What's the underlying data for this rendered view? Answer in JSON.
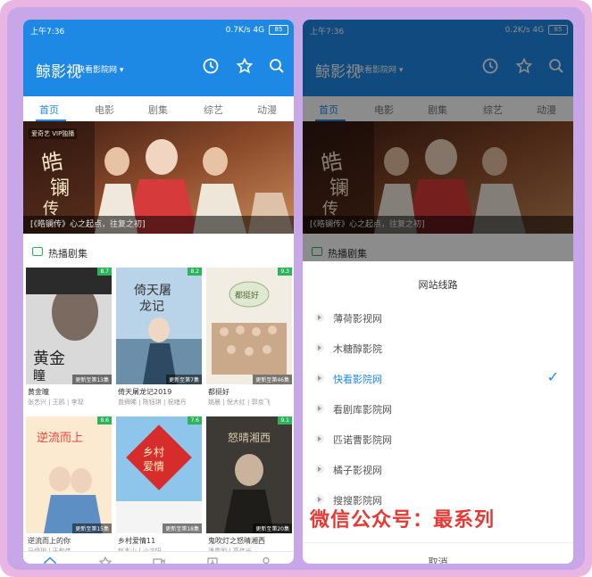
{
  "status": {
    "time": "上午7:36",
    "speed_left": "0.7K/s",
    "speed_right": "0.2K/s",
    "network": "4G",
    "battery": "85"
  },
  "app": {
    "title": "鲸影视",
    "source": "快看影院网"
  },
  "tabs": [
    "首页",
    "电影",
    "剧集",
    "综艺",
    "动漫"
  ],
  "banner": {
    "caption": "[《皓镧传》心之起点，往复之初]",
    "tag": "爱奇艺 VIP独播"
  },
  "section": {
    "title": "热播剧集"
  },
  "cards": [
    {
      "title": "黄金瞳",
      "actors": "张艺兴 | 王鸥 | 李现",
      "rating": "8.7",
      "update": "更新至第13集"
    },
    {
      "title": "倚天屠龙记2019",
      "actors": "曾舜晞 | 陈钰琪 | 祝绪丹",
      "rating": "8.2",
      "update": "更新至第7集"
    },
    {
      "title": "都挺好",
      "actors": "姚晨 | 倪大红 | 郭京飞",
      "rating": "9.3",
      "update": "更新至第46集"
    },
    {
      "title": "逆流而上的你",
      "actors": "马伊琍 | 于和伟",
      "rating": "8.6",
      "update": "更新至第15集"
    },
    {
      "title": "乡村爱情11",
      "actors": "赵本山 | 小沈阳",
      "rating": "7.6",
      "update": "更新至第18集"
    },
    {
      "title": "鬼吹灯之怒晴湘西",
      "actors": "潘粤明 | 高伟光",
      "rating": "9.1",
      "update": "更新至第20集"
    }
  ],
  "bottom_nav": [
    "首页",
    "更新",
    "直播",
    "资源",
    "我的"
  ],
  "dialog": {
    "title": "网站线路",
    "options": [
      "薄荷影视网",
      "木糖醇影院",
      "快看影院网",
      "看剧库影院网",
      "匹诺曹影院网",
      "橘子影视网",
      "搜搜影院网"
    ],
    "selected_index": 2,
    "check": "✓",
    "cancel": "取消"
  },
  "watermark": "微信公众号：最系列",
  "colors": {
    "primary": "#1e88e5",
    "accent": "#2db45a",
    "watermark": "#e53935"
  }
}
